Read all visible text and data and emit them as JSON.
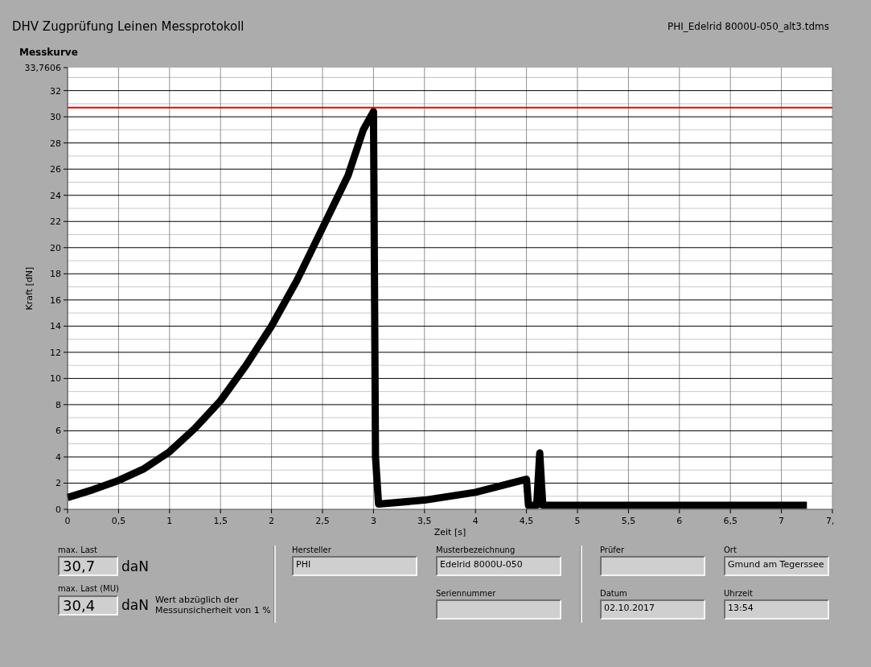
{
  "header": {
    "title": "DHV Zugprüfung Leinen Messprotokoll",
    "file_name": "PHI_Edelrid 8000U-050_alt3.tdms"
  },
  "chart_panel": {
    "title": "Messkurve",
    "chart_data": {
      "type": "line",
      "xlabel": "Zeit [s]",
      "ylabel": "Kraft [dN]",
      "xlim": [
        0,
        7.5
      ],
      "ylim": [
        0,
        33.7606
      ],
      "xticks": [
        {
          "value": 0,
          "label": "0"
        },
        {
          "value": 0.5,
          "label": "0,5"
        },
        {
          "value": 1,
          "label": "1"
        },
        {
          "value": 1.5,
          "label": "1,5"
        },
        {
          "value": 2,
          "label": "2"
        },
        {
          "value": 2.5,
          "label": "2,5"
        },
        {
          "value": 3,
          "label": "3"
        },
        {
          "value": 3.5,
          "label": "3,5"
        },
        {
          "value": 4,
          "label": "4"
        },
        {
          "value": 4.5,
          "label": "4,5"
        },
        {
          "value": 5,
          "label": "5"
        },
        {
          "value": 5.5,
          "label": "5,5"
        },
        {
          "value": 6,
          "label": "6"
        },
        {
          "value": 6.5,
          "label": "6,5"
        },
        {
          "value": 7,
          "label": "7"
        },
        {
          "value": 7.5,
          "label": "7,"
        }
      ],
      "yticks": [
        0,
        2,
        4,
        6,
        8,
        10,
        12,
        14,
        16,
        18,
        20,
        22,
        24,
        26,
        28,
        30,
        32,
        {
          "value": 33.7606,
          "label": "33,7606"
        }
      ],
      "grid": true,
      "x": [
        0,
        0.25,
        0.5,
        0.75,
        1,
        1.25,
        1.5,
        1.75,
        2,
        2.25,
        2.5,
        2.75,
        2.9,
        3.0,
        3.02,
        3.05,
        3.5,
        4,
        4.5,
        4.52,
        4.6,
        4.63,
        4.66,
        7.25,
        7.5
      ],
      "series": [
        {
          "color": "#000000",
          "values": [
            0.9,
            1.5,
            2.2,
            3.1,
            4.4,
            6.2,
            8.3,
            11,
            14,
            17.5,
            21.5,
            25.5,
            29,
            30.4,
            4,
            0.4,
            0.7,
            1.3,
            2.3,
            0.3,
            0.3,
            4.3,
            0.3,
            0.3,
            null
          ]
        },
        {
          "color": "#cc1111",
          "values": [
            30.7,
            30.7,
            30.7,
            30.7,
            30.7,
            30.7,
            30.7,
            30.7,
            30.7,
            30.7,
            30.7,
            30.7,
            30.7,
            30.7,
            30.7,
            30.7,
            30.7,
            30.7,
            30.7,
            30.7,
            30.7,
            30.7,
            30.7,
            30.7,
            30.7
          ]
        }
      ]
    }
  },
  "results": [
    {
      "label": "max. Last",
      "value": "30,7",
      "unit": "daN"
    },
    {
      "label": "max. Last (MU)",
      "value": "30,4",
      "unit": "daN",
      "note": "Wert abzüglich der Messunsicherheit von 1 %"
    }
  ],
  "info_fields": [
    {
      "label": "Hersteller",
      "value": "PHI"
    },
    {
      "label": "Musterbezeichnung",
      "value": "Edelrid 8000U-050"
    },
    {
      "label": "Prüfer"
    },
    {
      "label": "Ort",
      "value": "Gmund am Tegerssee"
    },
    {
      "label": "Seriennummer"
    },
    {
      "label": "Datum",
      "value": "02.10.2017"
    },
    {
      "label": "Uhrzeit",
      "value": "13:54"
    }
  ]
}
